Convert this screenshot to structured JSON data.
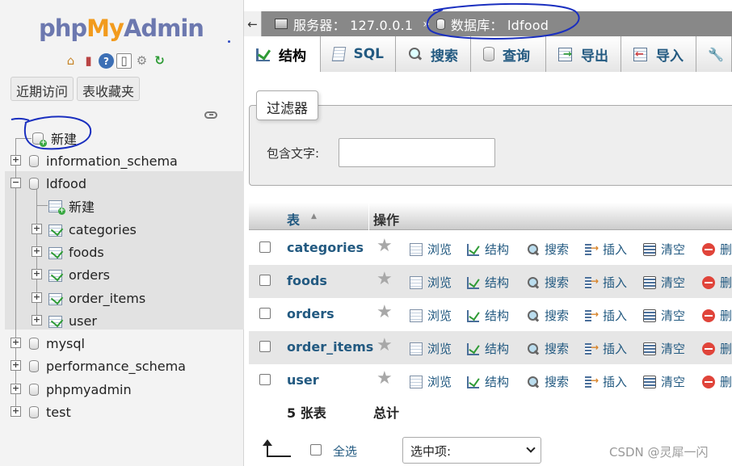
{
  "nav": {
    "logo": {
      "php": "php",
      "my": "My",
      "admin": "Admin"
    },
    "icons": [
      "home-icon",
      "exit-icon",
      "help-icon",
      "docs-icon",
      "settings-icon",
      "reload-icon"
    ],
    "tabs": {
      "recent": "近期访问",
      "favorites": "表收藏夹"
    },
    "tree": {
      "new": "新建",
      "databases": [
        {
          "name": "information_schema"
        },
        {
          "name": "ldfood",
          "new": "新建",
          "tables": [
            "categories",
            "foods",
            "orders",
            "order_items",
            "user"
          ]
        },
        {
          "name": "mysql"
        },
        {
          "name": "performance_schema"
        },
        {
          "name": "phpmyadmin"
        },
        {
          "name": "test"
        }
      ]
    }
  },
  "breadcrumb": {
    "server_label": "服务器：",
    "server": "127.0.0.1",
    "separator": "»",
    "db_label": "数据库：",
    "db": "ldfood"
  },
  "menu": {
    "tabs": [
      {
        "label": "结构",
        "icon": "structure-icon",
        "active": true
      },
      {
        "label": "SQL",
        "icon": "sql-icon"
      },
      {
        "label": "搜索",
        "icon": "search-icon"
      },
      {
        "label": "查询",
        "icon": "query-icon"
      },
      {
        "label": "导出",
        "icon": "export-icon"
      },
      {
        "label": "导入",
        "icon": "import-icon"
      },
      {
        "label": "",
        "icon": "wrench-icon"
      }
    ]
  },
  "filter": {
    "legend": "过滤器",
    "label": "包含文字:",
    "value": ""
  },
  "table": {
    "headers": {
      "table": "表",
      "sort": "▲",
      "operations": "操作"
    },
    "actions": [
      "浏览",
      "结构",
      "搜索",
      "插入",
      "清空",
      "删"
    ],
    "rows": [
      {
        "name": "categories"
      },
      {
        "name": "foods"
      },
      {
        "name": "orders"
      },
      {
        "name": "order_items"
      },
      {
        "name": "user"
      }
    ],
    "footer": {
      "count": "5 张表",
      "total": "总计"
    }
  },
  "bottom": {
    "select_all": "全选",
    "with_selected": "选中项:"
  },
  "watermark": "CSDN @灵犀一闪",
  "colors": {
    "link": "#235a81",
    "annotation": "#1a2fbf",
    "logo_blue": "#6c78af",
    "logo_orange": "#f29b1d"
  }
}
